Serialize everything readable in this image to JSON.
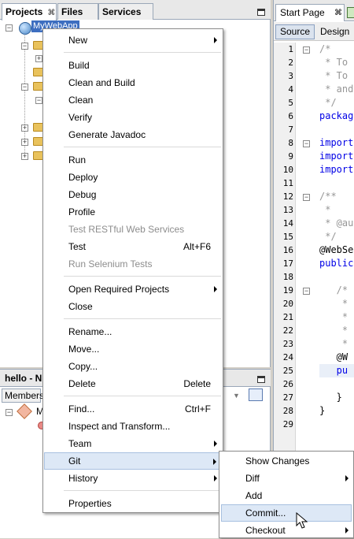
{
  "projects_panel": {
    "tabs": [
      {
        "label": "Projects",
        "close": "⌘"
      },
      {
        "label": "Files"
      },
      {
        "label": "Services"
      }
    ],
    "selected_node": "MyWebApp"
  },
  "navigator_panel": {
    "title": "hello - N",
    "members_label": "Members",
    "tree_label": "M"
  },
  "editor": {
    "tab_label": "Start Page",
    "source_label": "Source",
    "design_label": "Design",
    "line_numbers": [
      "1",
      "2",
      "3",
      "4",
      "5",
      "6",
      "7",
      "8",
      "9",
      "10",
      "11",
      "12",
      "13",
      "14",
      "15",
      "16",
      "17",
      "18",
      "19",
      "20",
      "21",
      "22",
      "23",
      "24",
      "25",
      "26",
      "27",
      "28",
      "29"
    ],
    "code_lines": [
      {
        "text": "/*",
        "kind": "cm"
      },
      {
        "text": " * To",
        "kind": "cm"
      },
      {
        "text": " * To",
        "kind": "cm"
      },
      {
        "text": " * and",
        "kind": "cm"
      },
      {
        "text": " */",
        "kind": "cm"
      },
      {
        "text": "packag",
        "kind": "kw"
      },
      {
        "text": "",
        "kind": "pl"
      },
      {
        "text": "import",
        "kind": "kw"
      },
      {
        "text": "import",
        "kind": "kw"
      },
      {
        "text": "import",
        "kind": "kw"
      },
      {
        "text": "",
        "kind": "pl"
      },
      {
        "text": "/**",
        "kind": "cm"
      },
      {
        "text": " *",
        "kind": "cm"
      },
      {
        "text": " * @au",
        "kind": "cm"
      },
      {
        "text": " */",
        "kind": "cm"
      },
      {
        "text": "@WebSe",
        "kind": "pl"
      },
      {
        "text": "public",
        "kind": "kw"
      },
      {
        "text": "",
        "kind": "pl"
      },
      {
        "text": "   /*",
        "kind": "cm"
      },
      {
        "text": "    *",
        "kind": "cm"
      },
      {
        "text": "    *",
        "kind": "cm"
      },
      {
        "text": "    *",
        "kind": "cm"
      },
      {
        "text": "    *",
        "kind": "cm"
      },
      {
        "text": "   @W",
        "kind": "pl"
      },
      {
        "text": "   pu",
        "kind": "kw"
      },
      {
        "text": "",
        "kind": "pl"
      },
      {
        "text": "   }",
        "kind": "pl"
      },
      {
        "text": "}",
        "kind": "pl"
      },
      {
        "text": "",
        "kind": "pl"
      }
    ]
  },
  "context_menu": {
    "items": [
      {
        "label": "New",
        "submenu": true
      },
      {
        "separator": true
      },
      {
        "label": "Build"
      },
      {
        "label": "Clean and Build"
      },
      {
        "label": "Clean"
      },
      {
        "label": "Verify"
      },
      {
        "label": "Generate Javadoc"
      },
      {
        "separator": true
      },
      {
        "label": "Run"
      },
      {
        "label": "Deploy"
      },
      {
        "label": "Debug"
      },
      {
        "label": "Profile"
      },
      {
        "label": "Test RESTful Web Services",
        "disabled": true
      },
      {
        "label": "Test",
        "shortcut": "Alt+F6"
      },
      {
        "label": "Run Selenium Tests",
        "disabled": true
      },
      {
        "separator": true
      },
      {
        "label": "Open Required Projects",
        "submenu": true
      },
      {
        "label": "Close"
      },
      {
        "separator": true
      },
      {
        "label": "Rename..."
      },
      {
        "label": "Move..."
      },
      {
        "label": "Copy..."
      },
      {
        "label": "Delete",
        "shortcut": "Delete"
      },
      {
        "separator": true
      },
      {
        "label": "Find...",
        "shortcut": "Ctrl+F"
      },
      {
        "label": "Inspect and Transform..."
      },
      {
        "label": "Team",
        "submenu": true
      },
      {
        "label": "Git",
        "submenu": true,
        "highlighted": true
      },
      {
        "label": "History",
        "submenu": true
      },
      {
        "separator": true
      },
      {
        "label": "Properties"
      }
    ]
  },
  "git_submenu": {
    "items": [
      {
        "label": "Show Changes"
      },
      {
        "label": "Diff",
        "submenu": true
      },
      {
        "label": "Add"
      },
      {
        "label": "Commit...",
        "highlighted": true
      },
      {
        "label": "Checkout",
        "submenu": true
      }
    ]
  },
  "colors": {
    "selection": "#3d6ec0",
    "menu_highlight": "#dde8f6",
    "keyword": "#0000e6",
    "comment": "#969696"
  }
}
